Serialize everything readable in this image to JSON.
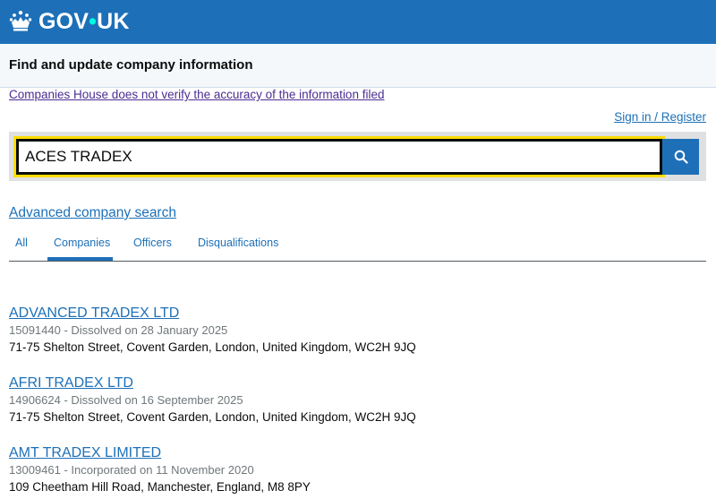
{
  "header": {
    "logo_text_gov": "GOV",
    "logo_text_dot": "•",
    "logo_text_uk": "UK",
    "logo_icon": "crown-icon",
    "background_color": "#1d70b8"
  },
  "service": {
    "name": "Find and update company information"
  },
  "disclaimer_link": "Companies House does not verify the accuracy of the information filed",
  "sign_in_link": "Sign in / Register",
  "search": {
    "value": "ACES TRADEX",
    "button_icon": "search-icon"
  },
  "advanced_search_link": "Advanced company search",
  "tabs": [
    {
      "label": "All",
      "active": false
    },
    {
      "label": "Companies",
      "active": true
    },
    {
      "label": "Officers",
      "active": false
    },
    {
      "label": "Disqualifications",
      "active": false
    }
  ],
  "results": [
    {
      "title": "ADVANCED TRADEX LTD",
      "meta": "15091440 - Dissolved on 28 January 2025",
      "address": "71-75 Shelton Street, Covent Garden, London, United Kingdom, WC2H 9JQ"
    },
    {
      "title": "AFRI TRADEX LTD",
      "meta": "14906624 - Dissolved on 16 September 2025",
      "address": "71-75 Shelton Street, Covent Garden, London, United Kingdom, WC2H 9JQ"
    },
    {
      "title": "AMT TRADEX LIMITED",
      "meta": "13009461 - Incorporated on 11 November 2020",
      "address": "109 Cheetham Hill Road, Manchester, England, M8 8PY"
    }
  ]
}
